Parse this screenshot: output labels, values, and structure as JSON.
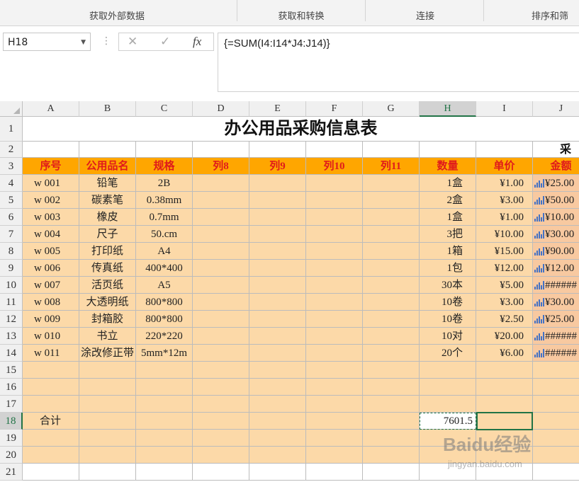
{
  "ribbon": {
    "groups": [
      {
        "label": "获取外部数据"
      },
      {
        "label": "获取和转换"
      },
      {
        "label": "连接"
      },
      {
        "label": "排序和筛"
      }
    ]
  },
  "formula_bar": {
    "name_box": "H18",
    "cancel_icon": "✕",
    "enter_icon": "✓",
    "fx_label": "fx",
    "formula": "{=SUM(I4:I14*J4:J14)}"
  },
  "columns": [
    "A",
    "B",
    "C",
    "D",
    "E",
    "F",
    "G",
    "H",
    "I",
    "J"
  ],
  "rows": [
    "1",
    "2",
    "3",
    "4",
    "5",
    "6",
    "7",
    "8",
    "9",
    "10",
    "11",
    "12",
    "13",
    "14",
    "15",
    "16",
    "17",
    "18",
    "19",
    "20",
    "21"
  ],
  "sheet": {
    "title": "办公用品采购信息表",
    "row2_label": "采",
    "headers": [
      "序号",
      "公用品名",
      "规格",
      "列8",
      "列9",
      "列10",
      "列11",
      "数量",
      "单价",
      "金额"
    ],
    "data": [
      [
        "w 001",
        "铅笔",
        "2B",
        "",
        "",
        "",
        "",
        "1盒",
        "¥1.00",
        "¥25.00"
      ],
      [
        "w 002",
        "碳素笔",
        "0.38mm",
        "",
        "",
        "",
        "",
        "2盒",
        "¥3.00",
        "¥50.00"
      ],
      [
        "w 003",
        "橡皮",
        "0.7mm",
        "",
        "",
        "",
        "",
        "1盒",
        "¥1.00",
        "¥10.00"
      ],
      [
        "w 004",
        "尺子",
        "50.cm",
        "",
        "",
        "",
        "",
        "3把",
        "¥10.00",
        "¥30.00"
      ],
      [
        "w 005",
        "打印纸",
        "A4",
        "",
        "",
        "",
        "",
        "1箱",
        "¥15.00",
        "¥90.00"
      ],
      [
        "w 006",
        "传真纸",
        "400*400",
        "",
        "",
        "",
        "",
        "1包",
        "¥12.00",
        "¥12.00"
      ],
      [
        "w 007",
        "活页纸",
        "A5",
        "",
        "",
        "",
        "",
        "30本",
        "¥5.00",
        "######"
      ],
      [
        "w 008",
        "大透明纸",
        "800*800",
        "",
        "",
        "",
        "",
        "10卷",
        "¥3.00",
        "¥30.00"
      ],
      [
        "w 009",
        "封箱胶",
        "800*800",
        "",
        "",
        "",
        "",
        "10卷",
        "¥2.50",
        "¥25.00"
      ],
      [
        "w 010",
        "书立",
        "220*220",
        "",
        "",
        "",
        "",
        "10对",
        "¥20.00",
        "######"
      ],
      [
        "w 011",
        "涂改修正带",
        "5mm*12m",
        "",
        "",
        "",
        "",
        "20个",
        "¥6.00",
        "######"
      ]
    ],
    "total_label": "合计",
    "total_value": "7601.5"
  },
  "colors": {
    "header_fill": "#ffa600",
    "header_text": "#e01b1b",
    "row_fill": "#fcd9a8",
    "selection": "#217346"
  },
  "watermark": {
    "brand": "Baidu经验",
    "url": "jingyan.baidu.com"
  }
}
